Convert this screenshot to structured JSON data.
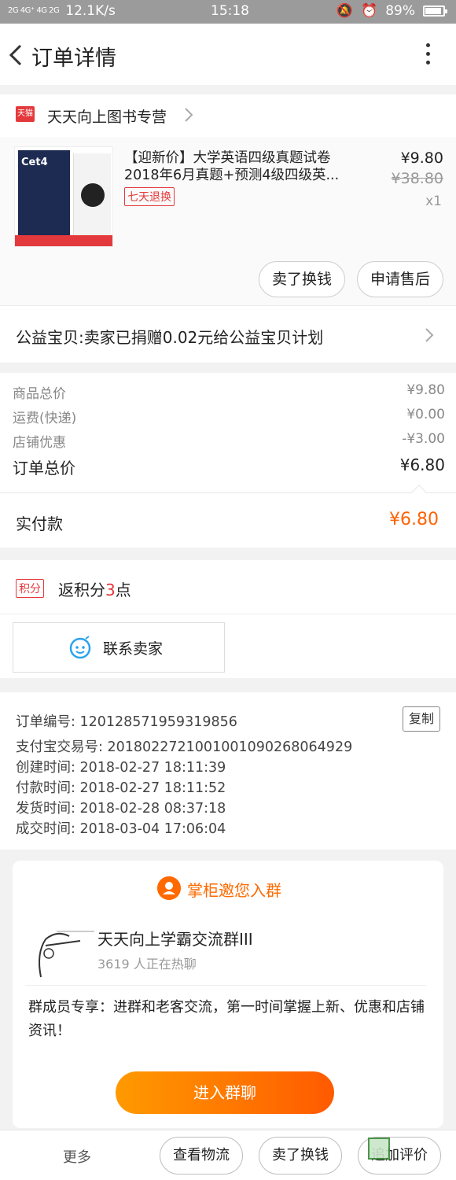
{
  "status_bar": {
    "signal": "2G 4G⁺ 4G 2G",
    "speed": "12.1K/s",
    "time": "15:18",
    "battery": "89%",
    "battery_level": 0.89
  },
  "nav": {
    "title": "订单详情"
  },
  "shop": {
    "badge": "天猫",
    "name": "天天向上图书专营"
  },
  "product": {
    "cover_text": "Cet4",
    "title": "【迎新价】大学英语四级真题试卷2018年6月真题+预测4级四级英...",
    "return_badge": "七天退换",
    "price_now": "¥9.80",
    "price_old": "¥38.80",
    "quantity": "x1",
    "btn_resell": "卖了换钱",
    "btn_aftersale": "申请售后"
  },
  "charity": {
    "text": "公益宝贝:卖家已捐赠0.02元给公益宝贝计划"
  },
  "summary": {
    "goods_label": "商品总价",
    "goods_value": "¥9.80",
    "shipping_label": "运费(快递)",
    "shipping_value": "¥0.00",
    "discount_label": "店铺优惠",
    "discount_value": "-¥3.00",
    "total_label": "订单总价",
    "total_value": "¥6.80",
    "paid_label": "实付款",
    "paid_value": "¥6.80"
  },
  "points": {
    "badge": "积分",
    "prefix": "返积分",
    "number": "3",
    "suffix": "点"
  },
  "contact": {
    "label": "联系卖家"
  },
  "order_info": {
    "order_no": "订单编号: 1201285719593198​56",
    "alipay_no": "支付宝交易号: 2018022721001001090268064929",
    "created": "创建时间: 2018-02-27 18:11:39",
    "paid": "付款时间: 2018-02-27 18:11:52",
    "shipped": "发货时间: 2018-02-28 08:37:18",
    "completed": "成交时间: 2018-03-04 17:06:04",
    "copy_label": "复制"
  },
  "group_invite": {
    "title": "掌柜邀您入群",
    "group_name": "天天向上学霸交流群III",
    "member_count": "3619 人正在热聊",
    "description": "群成员专享：进群和老客交流，第一时间掌握上新、优惠和店铺资讯！",
    "join_label": "进入群聊"
  },
  "bottom_bar": {
    "more": "更多",
    "logistics": "查看物流",
    "resell": "卖了换钱",
    "review": "追加评价"
  },
  "colors": {
    "accent_orange": "#ff6200",
    "tmall_red": "#e4393c"
  }
}
